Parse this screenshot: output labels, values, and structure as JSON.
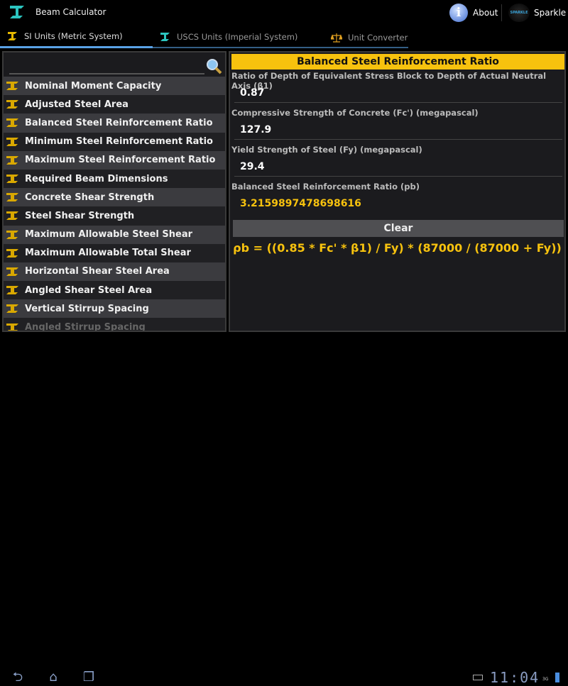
{
  "app": {
    "title": "Beam Calculator",
    "about": "About",
    "sparkle": "Sparkle",
    "sparkle_logo": "SPARKLE"
  },
  "tabs": [
    {
      "label": "SI Units (Metric System)"
    },
    {
      "label": "USCS Units (Imperial System)"
    },
    {
      "label": "Unit Converter"
    }
  ],
  "search": {
    "placeholder": ""
  },
  "list": [
    "Nominal Moment Capacity",
    "Adjusted Steel Area",
    "Balanced Steel Reinforcement Ratio",
    "Minimum Steel Reinforcement Ratio",
    "Maximum Steel Reinforcement Ratio",
    "Required Beam Dimensions",
    "Concrete Shear Strength",
    "Steel Shear Strength",
    "Maximum Allowable Steel Shear",
    "Maximum Allowable Total Shear",
    "Horizontal Shear Steel Area",
    "Angled Shear Steel Area",
    "Vertical Stirrup Spacing",
    "Angled Stirrup Spacing"
  ],
  "form": {
    "title": "Balanced Steel Reinforcement Ratio",
    "fields": [
      {
        "label": "Ratio of Depth of Equivalent Stress Block to Depth of Actual Neutral Axis (β1)",
        "value": "0.87"
      },
      {
        "label": "Compressive Strength of Concrete (Fc') (megapascal)",
        "value": "127.9"
      },
      {
        "label": "Yield Strength of Steel (Fy) (megapascal)",
        "value": "29.4"
      },
      {
        "label": "Balanced Steel Reinforcement Ratio (pb)",
        "value": "3.2159897478698616"
      }
    ],
    "clear": "Clear",
    "formula": "ρb = ((0.85 * Fc' * β1) / Fy) * (87000 / (87000 + Fy))"
  },
  "status": {
    "time": "11:04",
    "network": "3G"
  },
  "colors": {
    "accent": "#f7c20e",
    "tab_indicator": "#5aa2e6"
  }
}
